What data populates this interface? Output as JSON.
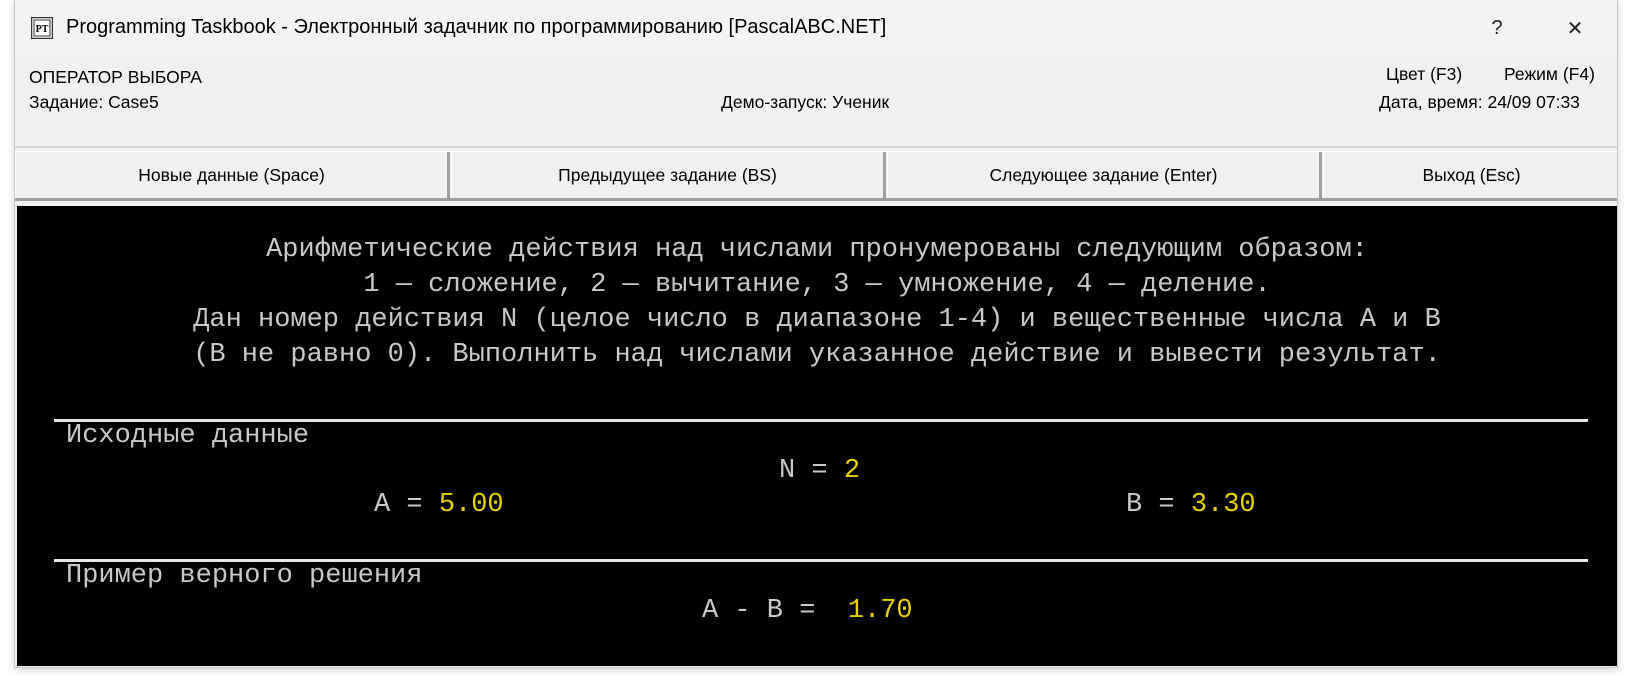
{
  "window": {
    "title": "Programming Taskbook - Электронный задачник по программированию [PascalABC.NET]",
    "help_label": "?",
    "close_label": "✕",
    "icon_label": "PT"
  },
  "info": {
    "topic": "ОПЕРАТОР ВЫБОРА",
    "task": "Задание: Case5",
    "demo": "Демо-запуск: Ученик",
    "color": "Цвет (F3)",
    "mode": "Режим (F4)",
    "datetime": "Дата, время: 24/09 07:33"
  },
  "buttons": {
    "new_data": "Новые данные (Space)",
    "prev_task": "Предыдущее задание (BS)",
    "next_task": "Следующее задание (Enter)",
    "exit": "Выход (Esc)"
  },
  "task_text": [
    "Арифметические действия над числами пронумерованы следующим образом:",
    "1 — сложение, 2 — вычитание, 3 — умножение, 4 — деление.",
    "Дан номер действия N (целое число в диапазоне 1-4) и вещественные числа A и B",
    "(B не равно 0). Выполнить над числами указанное действие и вывести результат."
  ],
  "source": {
    "title": "Исходные данные",
    "n_label": "N = ",
    "n_value": "2",
    "a_label": "A = ",
    "a_value": "5.00",
    "b_label": "B = ",
    "b_value": "3.30"
  },
  "solution": {
    "title": "Пример верного решения",
    "label": "A - B = ",
    "value": " 1.70"
  },
  "colors": {
    "console_bg": "#000000",
    "console_text": "#c8c8c8",
    "value_text": "#e8d200"
  }
}
